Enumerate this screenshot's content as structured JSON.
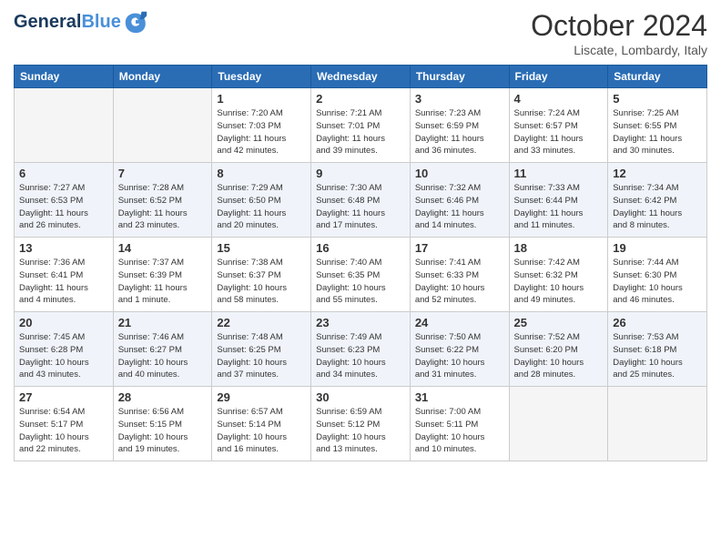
{
  "logo": {
    "line1": "General",
    "line2": "Blue"
  },
  "title": "October 2024",
  "subtitle": "Liscate, Lombardy, Italy",
  "weekdays": [
    "Sunday",
    "Monday",
    "Tuesday",
    "Wednesday",
    "Thursday",
    "Friday",
    "Saturday"
  ],
  "weeks": [
    [
      {
        "day": "",
        "info": ""
      },
      {
        "day": "",
        "info": ""
      },
      {
        "day": "1",
        "info": "Sunrise: 7:20 AM\nSunset: 7:03 PM\nDaylight: 11 hours\nand 42 minutes."
      },
      {
        "day": "2",
        "info": "Sunrise: 7:21 AM\nSunset: 7:01 PM\nDaylight: 11 hours\nand 39 minutes."
      },
      {
        "day": "3",
        "info": "Sunrise: 7:23 AM\nSunset: 6:59 PM\nDaylight: 11 hours\nand 36 minutes."
      },
      {
        "day": "4",
        "info": "Sunrise: 7:24 AM\nSunset: 6:57 PM\nDaylight: 11 hours\nand 33 minutes."
      },
      {
        "day": "5",
        "info": "Sunrise: 7:25 AM\nSunset: 6:55 PM\nDaylight: 11 hours\nand 30 minutes."
      }
    ],
    [
      {
        "day": "6",
        "info": "Sunrise: 7:27 AM\nSunset: 6:53 PM\nDaylight: 11 hours\nand 26 minutes."
      },
      {
        "day": "7",
        "info": "Sunrise: 7:28 AM\nSunset: 6:52 PM\nDaylight: 11 hours\nand 23 minutes."
      },
      {
        "day": "8",
        "info": "Sunrise: 7:29 AM\nSunset: 6:50 PM\nDaylight: 11 hours\nand 20 minutes."
      },
      {
        "day": "9",
        "info": "Sunrise: 7:30 AM\nSunset: 6:48 PM\nDaylight: 11 hours\nand 17 minutes."
      },
      {
        "day": "10",
        "info": "Sunrise: 7:32 AM\nSunset: 6:46 PM\nDaylight: 11 hours\nand 14 minutes."
      },
      {
        "day": "11",
        "info": "Sunrise: 7:33 AM\nSunset: 6:44 PM\nDaylight: 11 hours\nand 11 minutes."
      },
      {
        "day": "12",
        "info": "Sunrise: 7:34 AM\nSunset: 6:42 PM\nDaylight: 11 hours\nand 8 minutes."
      }
    ],
    [
      {
        "day": "13",
        "info": "Sunrise: 7:36 AM\nSunset: 6:41 PM\nDaylight: 11 hours\nand 4 minutes."
      },
      {
        "day": "14",
        "info": "Sunrise: 7:37 AM\nSunset: 6:39 PM\nDaylight: 11 hours\nand 1 minute."
      },
      {
        "day": "15",
        "info": "Sunrise: 7:38 AM\nSunset: 6:37 PM\nDaylight: 10 hours\nand 58 minutes."
      },
      {
        "day": "16",
        "info": "Sunrise: 7:40 AM\nSunset: 6:35 PM\nDaylight: 10 hours\nand 55 minutes."
      },
      {
        "day": "17",
        "info": "Sunrise: 7:41 AM\nSunset: 6:33 PM\nDaylight: 10 hours\nand 52 minutes."
      },
      {
        "day": "18",
        "info": "Sunrise: 7:42 AM\nSunset: 6:32 PM\nDaylight: 10 hours\nand 49 minutes."
      },
      {
        "day": "19",
        "info": "Sunrise: 7:44 AM\nSunset: 6:30 PM\nDaylight: 10 hours\nand 46 minutes."
      }
    ],
    [
      {
        "day": "20",
        "info": "Sunrise: 7:45 AM\nSunset: 6:28 PM\nDaylight: 10 hours\nand 43 minutes."
      },
      {
        "day": "21",
        "info": "Sunrise: 7:46 AM\nSunset: 6:27 PM\nDaylight: 10 hours\nand 40 minutes."
      },
      {
        "day": "22",
        "info": "Sunrise: 7:48 AM\nSunset: 6:25 PM\nDaylight: 10 hours\nand 37 minutes."
      },
      {
        "day": "23",
        "info": "Sunrise: 7:49 AM\nSunset: 6:23 PM\nDaylight: 10 hours\nand 34 minutes."
      },
      {
        "day": "24",
        "info": "Sunrise: 7:50 AM\nSunset: 6:22 PM\nDaylight: 10 hours\nand 31 minutes."
      },
      {
        "day": "25",
        "info": "Sunrise: 7:52 AM\nSunset: 6:20 PM\nDaylight: 10 hours\nand 28 minutes."
      },
      {
        "day": "26",
        "info": "Sunrise: 7:53 AM\nSunset: 6:18 PM\nDaylight: 10 hours\nand 25 minutes."
      }
    ],
    [
      {
        "day": "27",
        "info": "Sunrise: 6:54 AM\nSunset: 5:17 PM\nDaylight: 10 hours\nand 22 minutes."
      },
      {
        "day": "28",
        "info": "Sunrise: 6:56 AM\nSunset: 5:15 PM\nDaylight: 10 hours\nand 19 minutes."
      },
      {
        "day": "29",
        "info": "Sunrise: 6:57 AM\nSunset: 5:14 PM\nDaylight: 10 hours\nand 16 minutes."
      },
      {
        "day": "30",
        "info": "Sunrise: 6:59 AM\nSunset: 5:12 PM\nDaylight: 10 hours\nand 13 minutes."
      },
      {
        "day": "31",
        "info": "Sunrise: 7:00 AM\nSunset: 5:11 PM\nDaylight: 10 hours\nand 10 minutes."
      },
      {
        "day": "",
        "info": ""
      },
      {
        "day": "",
        "info": ""
      }
    ]
  ]
}
